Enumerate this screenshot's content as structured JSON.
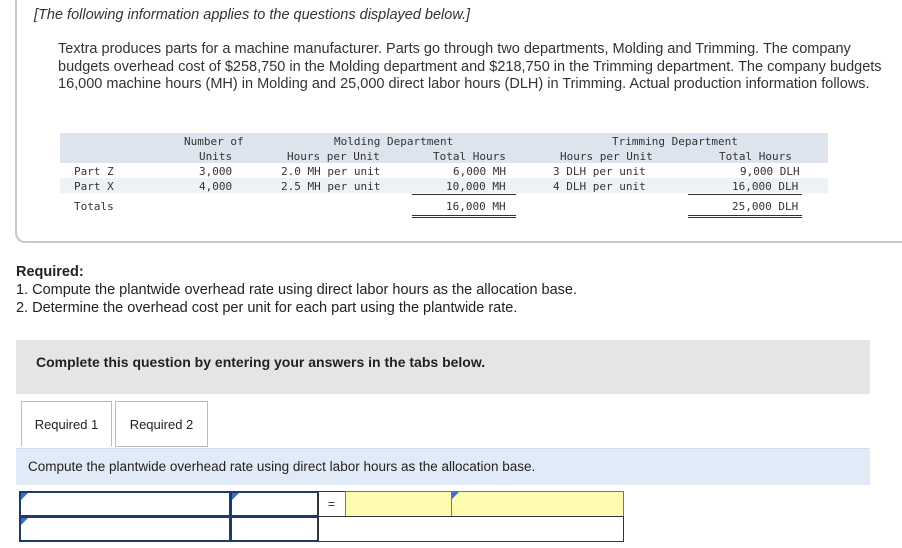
{
  "intro": {
    "header": "[The following information applies to the questions displayed below.]",
    "paragraph": "Textra produces parts for a machine manufacturer. Parts go through two departments, Molding and Trimming. The company budgets overhead cost of $258,750 in the Molding department and $218,750 in the Trimming department. The company budgets 16,000 machine hours (MH) in Molding and 25,000 direct labor hours (DLH) in Trimming. Actual production information follows."
  },
  "table": {
    "headers": {
      "units_top": "Number of",
      "units_bottom": "Units",
      "molding_group": "Molding Department",
      "molding_hpu": "Hours per Unit",
      "molding_total": "Total Hours",
      "trimming_group": "Trimming Department",
      "trimming_hpu": "Hours per Unit",
      "trimming_total": "Total Hours"
    },
    "rows": [
      {
        "part": "Part Z",
        "units": "3,000",
        "m_hpu": "2.0 MH per unit",
        "m_total": "6,000 MH",
        "t_hpu": "3 DLH per unit",
        "t_total": "9,000 DLH"
      },
      {
        "part": "Part X",
        "units": "4,000",
        "m_hpu": "2.5 MH per unit",
        "m_total": "10,000 MH",
        "t_hpu": "4 DLH per unit",
        "t_total": "16,000 DLH"
      }
    ],
    "totals": {
      "label": "Totals",
      "m_total": "16,000 MH",
      "t_total": "25,000 DLH"
    }
  },
  "required": {
    "title": "Required:",
    "item1": "1. Compute the plantwide overhead rate using direct labor hours as the allocation base.",
    "item2": "2. Determine the overhead cost per unit for each part using the plantwide rate."
  },
  "complete_bar": "Complete this question by entering your answers in the tabs below.",
  "tabs": [
    {
      "label": "Required 1"
    },
    {
      "label": "Required 2"
    }
  ],
  "instruction": "Compute the plantwide overhead rate using direct labor hours as the allocation base.",
  "grid": {
    "equals": "=",
    "inputs": [
      "",
      "",
      "",
      "",
      "",
      "",
      ""
    ]
  },
  "colors": {
    "header_shade": "#dde4ee",
    "instruction_bar": "#e1ebf7",
    "answer_cell": "#fffbb0",
    "dropdown_marker": "#3a6fc4"
  }
}
